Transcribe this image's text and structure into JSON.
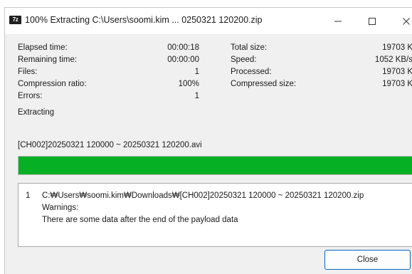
{
  "window": {
    "icon_label": "7z",
    "title": "100% Extracting C:\\Users\\soomi.kim ... 0250321 120200.zip"
  },
  "stats_left": [
    {
      "label": "Elapsed time:",
      "value": "00:00:18"
    },
    {
      "label": "Remaining time:",
      "value": "00:00:00"
    },
    {
      "label": "Files:",
      "value": "1"
    },
    {
      "label": "Compression ratio:",
      "value": "100%"
    },
    {
      "label": "Errors:",
      "value": "1"
    }
  ],
  "stats_right": [
    {
      "label": "Total size:",
      "value": "19703 K"
    },
    {
      "label": "Speed:",
      "value": "1052 KB/s"
    },
    {
      "label": "Processed:",
      "value": "19703 K"
    },
    {
      "label": "Compressed size:",
      "value": "19703 K"
    }
  ],
  "status": "Extracting",
  "current_file": "[CH002]20250321 120000 ~ 20250321 120200.avi",
  "progress": {
    "percent": 100,
    "color": "#06b025"
  },
  "messages": {
    "index": "1",
    "path": "C:₩Users₩soomi.kim₩Downloads₩[CH002]20250321 120000 ~ 20250321 120200.zip",
    "warning_label": "Warnings:",
    "warning_text": "There are some data after the end of the payload data"
  },
  "buttons": {
    "close_label": "Close"
  },
  "accent_color": "#0067c0"
}
